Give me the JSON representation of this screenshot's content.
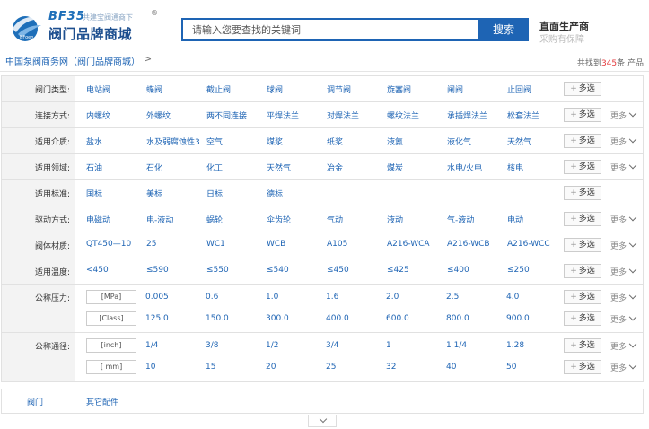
{
  "header": {
    "logo_brand": "BF35",
    "logo_slogan": "共建宝阀通商下",
    "logo_reg": "®",
    "logo_title": "阀门品牌商城",
    "search_placeholder": "请输入您要查找的关键词",
    "search_button": "搜索",
    "slogan_1": "直面生产商",
    "slogan_2": "采购有保障",
    "brand_color": "#1e64b4"
  },
  "breadcrumb": {
    "text": "中国泵阀商务网（阀门品牌商城）",
    "arrow": ">"
  },
  "result_count": {
    "prefix": "共找到",
    "number": "345",
    "suffix": "条 产品"
  },
  "filters": [
    {
      "label": "阀门类型:",
      "items": [
        "电站阀",
        "蝶阀",
        "截止阀",
        "球阀",
        "调节阀",
        "旋塞阀",
        "闸阀",
        "止回阀"
      ],
      "multi": "多选",
      "more": ""
    },
    {
      "label": "连接方式:",
      "items": [
        "内螺纹",
        "外螺纹",
        "两不同连接",
        "平焊法兰",
        "对焊法兰",
        "螺纹法兰",
        "承插焊法兰",
        "松套法兰"
      ],
      "multi": "多选",
      "more": "更多"
    },
    {
      "label": "适用介质:",
      "items": [
        "盐水",
        "水及弱腐蚀性3",
        "空气",
        "煤浆",
        "纸浆",
        "液氨",
        "液化气",
        "天然气"
      ],
      "multi": "多选",
      "more": "更多"
    },
    {
      "label": "适用领域:",
      "items": [
        "石油",
        "石化",
        "化工",
        "天然气",
        "冶金",
        "煤炭",
        "水电/火电",
        "核电"
      ],
      "multi": "多选",
      "more": "更多"
    },
    {
      "label": "适用标准:",
      "items": [
        "国标",
        "美标",
        "日标",
        "德标"
      ],
      "multi": "多选",
      "more": ""
    },
    {
      "label": "驱动方式:",
      "items": [
        "电磁动",
        "电-液动",
        "蜗轮",
        "伞齿轮",
        "气动",
        "液动",
        "气-液动",
        "电动"
      ],
      "multi": "多选",
      "more": "更多"
    },
    {
      "label": "阀体材质:",
      "items": [
        "QT450—10",
        "25",
        "WC1",
        "WCB",
        "A105",
        "A216-WCA",
        "A216-WCB",
        "A216-WCC"
      ],
      "multi": "多选",
      "more": "更多"
    },
    {
      "label": "适用温度:",
      "items": [
        "<450",
        "≤590",
        "≤550",
        "≤540",
        "≤450",
        "≤425",
        "≤400",
        "≤250"
      ],
      "multi": "多选",
      "more": "更多"
    }
  ],
  "pressure": {
    "label": "公称压力:",
    "rows": [
      {
        "unit": "[MPa]",
        "items": [
          "0.005",
          "0.6",
          "1.0",
          "1.6",
          "2.0",
          "2.5",
          "4.0"
        ],
        "multi": "多选",
        "more": "更多"
      },
      {
        "unit": "[Class]",
        "items": [
          "125.0",
          "150.0",
          "300.0",
          "400.0",
          "600.0",
          "800.0",
          "900.0"
        ],
        "multi": "多选",
        "more": "更多"
      }
    ]
  },
  "diameter": {
    "label": "公称通径:",
    "rows": [
      {
        "unit": "[inch]",
        "items": [
          "1/4",
          "3/8",
          "1/2",
          "3/4",
          "1",
          "1 1/4",
          "1.28"
        ],
        "multi": "多选",
        "more": "更多"
      },
      {
        "unit": "[ mm]",
        "items": [
          "10",
          "15",
          "20",
          "25",
          "32",
          "40",
          "50"
        ],
        "multi": "多选",
        "more": "更多"
      }
    ]
  },
  "categories": [
    "阀门",
    "其它配件"
  ]
}
